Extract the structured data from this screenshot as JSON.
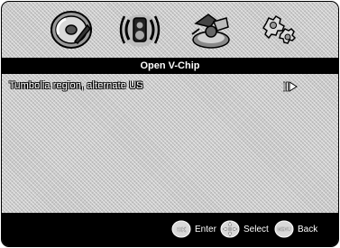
{
  "menu_icons": [
    {
      "name": "setup-disc-icon"
    },
    {
      "name": "audio-speaker-icon"
    },
    {
      "name": "preferences-toy-icon"
    },
    {
      "name": "settings-gears-icon"
    }
  ],
  "title": "Open V-Chip",
  "items": [
    {
      "label": "Tumbolia region, alternate US"
    }
  ],
  "footer": {
    "enter": {
      "icon_text": "OK",
      "label": "Enter"
    },
    "select": {
      "label": "Select"
    },
    "back": {
      "icon_text": "MENU",
      "label": "Back"
    }
  },
  "colors": {
    "bar": "#000000",
    "background": "#c9c9c9",
    "text": "#ffffff"
  }
}
